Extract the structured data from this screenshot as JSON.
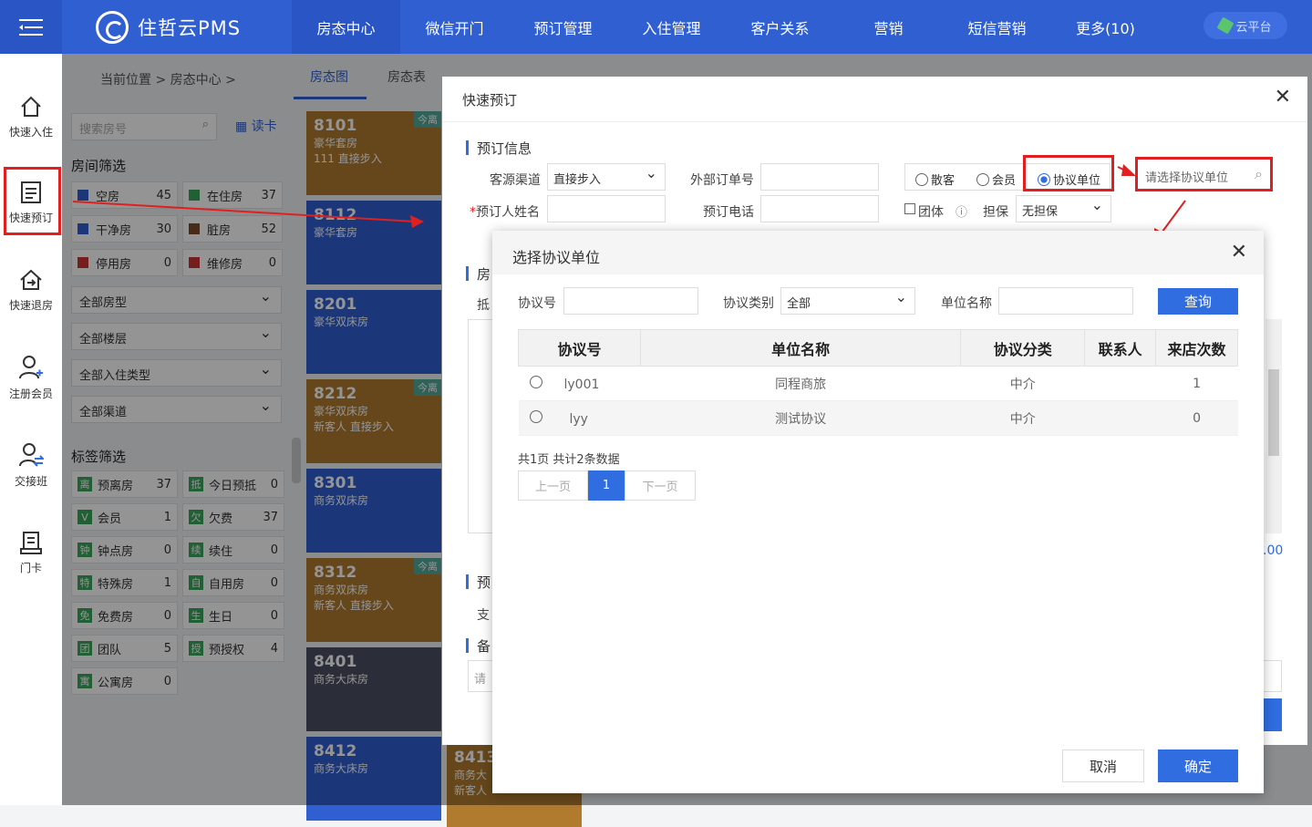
{
  "header": {
    "logo_text": "住哲云PMS",
    "nav": [
      "房态中心",
      "微信开门",
      "预订管理",
      "入住管理",
      "客户关系",
      "营销",
      "短信营销",
      "更多(10)"
    ],
    "cloud": "云平台"
  },
  "sidebar": [
    "快速入住",
    "快速预订",
    "快速退房",
    "注册会员",
    "交接班",
    "门卡"
  ],
  "breadcrumb": "当前位置 > 房态中心 >",
  "subtabs": [
    "房态图",
    "房态表"
  ],
  "filter": {
    "search_placeholder": "搜索房号",
    "read_card": "读卡",
    "room_filter_title": "房间筛选",
    "stats": [
      {
        "label": "空房",
        "num": "45",
        "color": "#2f5fd1"
      },
      {
        "label": "在住房",
        "num": "37",
        "color": "#3aa55a"
      },
      {
        "label": "干净房",
        "num": "30",
        "color": "#2f5fd1"
      },
      {
        "label": "脏房",
        "num": "52",
        "color": "#7a4a2a"
      },
      {
        "label": "停用房",
        "num": "0",
        "color": "#c33"
      },
      {
        "label": "维修房",
        "num": "0",
        "color": "#c33"
      }
    ],
    "dropdowns": [
      "全部房型",
      "全部楼层",
      "全部入住类型",
      "全部渠道"
    ],
    "tag_filter_title": "标签筛选",
    "tags": [
      {
        "icon": "离",
        "label": "预离房",
        "num": "37"
      },
      {
        "icon": "抵",
        "label": "今日预抵",
        "num": "0"
      },
      {
        "icon": "V",
        "label": "会员",
        "num": "1"
      },
      {
        "icon": "欠",
        "label": "欠费",
        "num": "37"
      },
      {
        "icon": "钟",
        "label": "钟点房",
        "num": "0"
      },
      {
        "icon": "续",
        "label": "续住",
        "num": "0"
      },
      {
        "icon": "特",
        "label": "特殊房",
        "num": "1"
      },
      {
        "icon": "自",
        "label": "自用房",
        "num": "0"
      },
      {
        "icon": "免",
        "label": "免费房",
        "num": "0"
      },
      {
        "icon": "生",
        "label": "生日",
        "num": "0"
      },
      {
        "icon": "团",
        "label": "团队",
        "num": "5"
      },
      {
        "icon": "授",
        "label": "预授权",
        "num": "4"
      },
      {
        "icon": "寓",
        "label": "公寓房",
        "num": "0"
      }
    ]
  },
  "rooms": [
    {
      "no": "8101",
      "type": "豪华套房",
      "line3": "111 直接步入",
      "badge": "今离"
    },
    {
      "no": "8112",
      "type": "豪华套房",
      "line3": "",
      "badge": ""
    },
    {
      "no": "8201",
      "type": "豪华双床房",
      "line3": "",
      "badge": ""
    },
    {
      "no": "8212",
      "type": "豪华双床房",
      "line3": "新客人 直接步入",
      "badge": "今离"
    },
    {
      "no": "8301",
      "type": "商务双床房",
      "line3": "",
      "badge": ""
    },
    {
      "no": "8312",
      "type": "商务双床房",
      "line3": "新客人 直接步入",
      "badge": "今离"
    },
    {
      "no": "8401",
      "type": "商务大床房",
      "line3": "",
      "badge": ""
    },
    {
      "no": "8412",
      "type": "商务大床房",
      "line3": "",
      "badge": ""
    },
    {
      "no": "8413",
      "type": "商务大",
      "line3": "新客人",
      "badge": ""
    }
  ],
  "quick_booking": {
    "title": "快速预订",
    "section_booking": "预订信息",
    "channel_label": "客源渠道",
    "channel_value": "直接步入",
    "ext_order_label": "外部订单号",
    "type_options": [
      "散客",
      "会员",
      "协议单位"
    ],
    "agreement_placeholder": "请选择协议单位",
    "booker_label": "预订人姓名",
    "phone_label": "预订电话",
    "group_label": "团体",
    "guarantee_label": "担保",
    "guarantee_value": "无担保",
    "amount_fragment": ".00",
    "partial_left": [
      "房",
      "抵",
      "预",
      "支",
      "备",
      "请"
    ]
  },
  "agreement": {
    "title": "选择协议单位",
    "no_label": "协议号",
    "category_label": "协议类别",
    "category_value": "全部",
    "name_label": "单位名称",
    "query_btn": "查询",
    "columns": [
      "协议号",
      "单位名称",
      "协议分类",
      "联系人",
      "来店次数"
    ],
    "rows": [
      {
        "no": "ly001",
        "name": "同程商旅",
        "category": "中介",
        "contact": "",
        "visits": "1"
      },
      {
        "no": "lyy",
        "name": "测试协议",
        "category": "中介",
        "contact": "",
        "visits": "0"
      }
    ],
    "summary": "共1页 共计2条数据",
    "prev": "上一页",
    "page": "1",
    "next": "下一页",
    "cancel": "取消",
    "confirm": "确定"
  }
}
